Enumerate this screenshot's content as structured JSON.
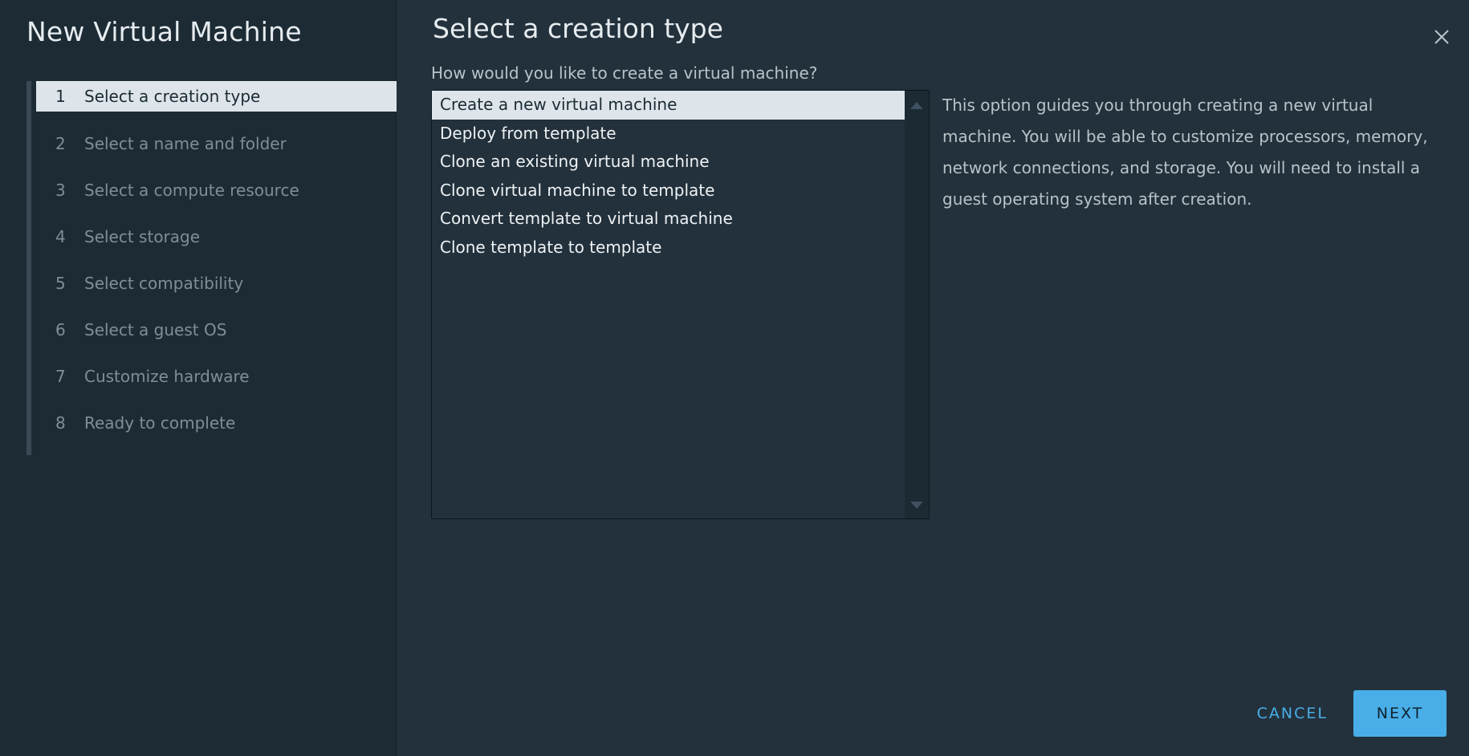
{
  "wizard": {
    "title": "New Virtual Machine",
    "steps": [
      {
        "num": "1",
        "label": "Select a creation type"
      },
      {
        "num": "2",
        "label": "Select a name and folder"
      },
      {
        "num": "3",
        "label": "Select a compute resource"
      },
      {
        "num": "4",
        "label": "Select storage"
      },
      {
        "num": "5",
        "label": "Select compatibility"
      },
      {
        "num": "6",
        "label": "Select a guest OS"
      },
      {
        "num": "7",
        "label": "Customize hardware"
      },
      {
        "num": "8",
        "label": "Ready to complete"
      }
    ],
    "active_step": 1
  },
  "page": {
    "title": "Select a creation type",
    "question": "How would you like to create a virtual machine?",
    "options": [
      "Create a new virtual machine",
      "Deploy from template",
      "Clone an existing virtual machine",
      "Clone virtual machine to template",
      "Convert template to virtual machine",
      "Clone template to template"
    ],
    "selected_option": "Create a new virtual machine",
    "description": "This option guides you through creating a new virtual machine. You will be able to customize processors, memory, network connections, and storage. You will need to install a guest operating system after creation."
  },
  "footer": {
    "cancel_label": "CANCEL",
    "next_label": "NEXT"
  },
  "icons": {
    "close": "close-icon",
    "scroll_up": "scroll-up-arrow-icon",
    "scroll_down": "scroll-down-arrow-icon"
  },
  "colors": {
    "accent": "#49aee8",
    "selected_bg": "#dde5ea",
    "panel_bg": "#23313c",
    "sidebar_bg": "#1d2b35"
  }
}
